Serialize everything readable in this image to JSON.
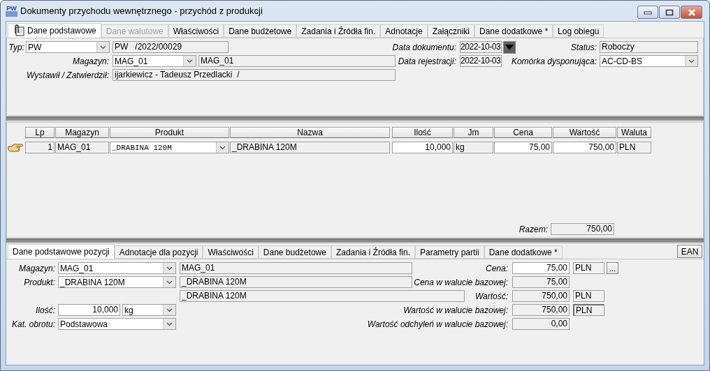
{
  "window": {
    "app_icon": "PW",
    "title": "Dokumenty przychodu wewnętrznego - przychód z produkcji"
  },
  "tabs": [
    {
      "label": "Dane podstawowe",
      "selected": true,
      "disabled": false
    },
    {
      "label": "Dane walutowe",
      "selected": false,
      "disabled": true
    },
    {
      "label": "Właściwości",
      "selected": false,
      "disabled": false
    },
    {
      "label": "Dane budżetowe",
      "selected": false,
      "disabled": false
    },
    {
      "label": "Zadania i Źródła fin.",
      "selected": false,
      "disabled": false
    },
    {
      "label": "Adnotacje",
      "selected": false,
      "disabled": false
    },
    {
      "label": "Załączniki",
      "selected": false,
      "disabled": false
    },
    {
      "label": "Dane dodatkowe *",
      "selected": false,
      "disabled": false
    },
    {
      "label": "Log obiegu",
      "selected": false,
      "disabled": false
    }
  ],
  "header": {
    "type": {
      "label": "Typ:",
      "value": "PW"
    },
    "number": "PW   /2022/00029",
    "warehouse": {
      "label": "Magazyn:",
      "code": "MAG_01",
      "name": "MAG_01"
    },
    "issued_by": {
      "label": "Wystawił / Zatwierdził:",
      "value": "ijarkiewicz - Tadeusz Przedlacki  /"
    },
    "document_date": {
      "label": "Data dokumentu:",
      "value": "2022-10-03"
    },
    "registration_date": {
      "label": "Data rejestracji:",
      "value": "2022-10-03"
    },
    "status": {
      "label": "Status:",
      "value": "Roboczy"
    },
    "department": {
      "label": "Komórka dysponująca:",
      "value": "AC-CD-BS"
    }
  },
  "grid": {
    "columns": [
      "Lp",
      "Magazyn",
      "Produkt",
      "Nazwa",
      "Ilość",
      "Jm",
      "Cena",
      "Wartość",
      "Waluta"
    ],
    "rows": [
      {
        "lp": "1",
        "warehouse": "MAG_01",
        "product": "_DRABINA 120M",
        "name": "_DRABINA 120M",
        "quantity": "10,000",
        "unit": "kg",
        "price": "75,00",
        "value": "750,00",
        "currency": "PLN"
      }
    ],
    "total": {
      "label": "Razem:",
      "value": "750,00"
    }
  },
  "position_tabs": [
    {
      "label": "Dane podstawowe pozycji",
      "selected": true
    },
    {
      "label": "Adnotacje dla pozycji",
      "selected": false
    },
    {
      "label": "Właściwości",
      "selected": false
    },
    {
      "label": "Dane budżetowe",
      "selected": false
    },
    {
      "label": "Zadania i Źródła fin.",
      "selected": false
    },
    {
      "label": "Parametry partii",
      "selected": false
    },
    {
      "label": "Dane dodatkowe *",
      "selected": false
    }
  ],
  "ean_button": "EAN",
  "position": {
    "warehouse": {
      "label": "Magazyn:",
      "code": "MAG_01",
      "name": "MAG_01"
    },
    "product": {
      "label": "Produkt:",
      "code": "_DRABINA 120M",
      "name": "_DRABINA 120M",
      "description": "_DRABINA 120M"
    },
    "quantity": {
      "label": "Ilość:",
      "value": "10,000",
      "unit": "kg"
    },
    "turnover_category": {
      "label": "Kat. obrotu:",
      "value": "Podstawowa"
    },
    "price": {
      "label": "Cena:",
      "value": "75,00",
      "currency": "PLN",
      "more": "..."
    },
    "base_price": {
      "label": "Cena w walucie bazowej:",
      "value": "75,00"
    },
    "value": {
      "label": "Wartość:",
      "value": "750,00",
      "currency": "PLN"
    },
    "base_value": {
      "label": "Wartość w walucie bazowej:",
      "value": "750,00",
      "currency": "PLN"
    },
    "deviation": {
      "label": "Wartość odchyleń w walucie bazowej:",
      "value": "0,00"
    }
  }
}
